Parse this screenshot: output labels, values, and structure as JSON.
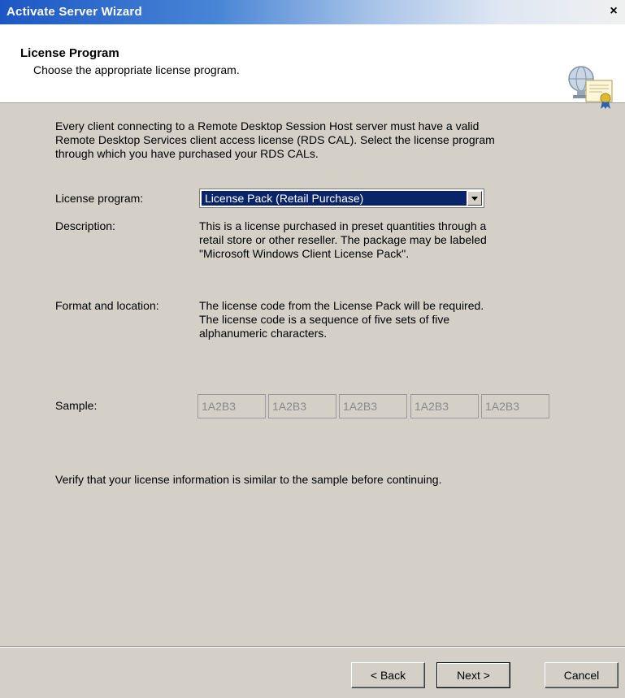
{
  "window": {
    "title": "Activate Server Wizard",
    "close_label": "×"
  },
  "header": {
    "title": "License Program",
    "subtitle": "Choose the appropriate license program.",
    "icon": "server-license-icon"
  },
  "intro": {
    "line1": "Every client connecting to a Remote Desktop Session Host server must have a valid",
    "line2": "Remote Desktop Services client access license (RDS CAL). Select the license program",
    "line3": "through which you have purchased your RDS CALs."
  },
  "license_program": {
    "label": "License program:",
    "selected": "License Pack (Retail Purchase)"
  },
  "description": {
    "label": "Description:",
    "line1": "This is a license purchased in preset quantities through a",
    "line2": "retail store or other reseller. The package may be labeled",
    "line3": "\"Microsoft Windows Client License Pack\"."
  },
  "format": {
    "label": "Format and location:",
    "line1": "The license code from the License Pack will be required.",
    "line2": "The license code is a sequence of five sets of five",
    "line3": "alphanumeric characters."
  },
  "sample": {
    "label": "Sample:",
    "values": [
      "1A2B3",
      "1A2B3",
      "1A2B3",
      "1A2B3",
      "1A2B3"
    ]
  },
  "verify_text": "Verify that your license information is similar to the sample before continuing.",
  "buttons": {
    "back": "< Back",
    "next": "Next >",
    "cancel": "Cancel"
  }
}
